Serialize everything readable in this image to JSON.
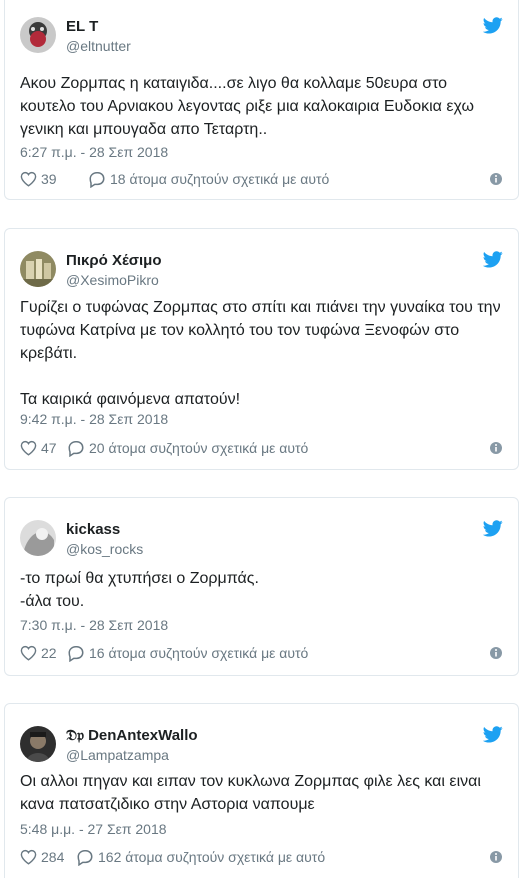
{
  "tweets": [
    {
      "name": "EL T",
      "handle": "@eltnutter",
      "text": "Ακου Ζορμπας η καταιγιδα....σε λιγο θα κολλαμε 50ευρα στο κουτελο του Αρνιακου λεγοντας ριξε μια καλοκαιρια Ευδοκια εχω γενικη και μπουγαδα απο Τεταρτη..",
      "timestamp": "6:27 π.μ. - 28 Σεπ 2018",
      "likes": "39",
      "replies": "18 άτομα συζητούν σχετικά με αυτό"
    },
    {
      "name": "Πικρό Χέσιμο",
      "handle": "@XesimoPikro",
      "text": "Γυρίζει ο τυφώνας Ζορμπας στο σπίτι  και πιάνει την γυναίκα του την τυφώνα Κατρίνα με τον κολλητό του τον τυφώνα Ξενοφών στο κρεβάτι.\n\nΤα καιρικά φαινόμενα απατούν!",
      "timestamp": "9:42 π.μ. - 28 Σεπ 2018",
      "likes": "47",
      "replies": "20 άτομα συζητούν σχετικά με αυτό"
    },
    {
      "name": "kickass",
      "handle": "@kos_rocks",
      "text": "-το πρωί θα χτυπήσει ο Ζορμπάς.\n-άλα του.",
      "timestamp": "7:30 π.μ. - 28 Σεπ 2018",
      "likes": "22",
      "replies": "16 άτομα συζητούν σχετικά με αυτό"
    },
    {
      "name": "𝔇𝔭 DenAntexWallo",
      "handle": "@Lampatzampa",
      "text": "Οι αλλοι πηγαν και ειπαν τον κυκλωνα Ζορμπας φιλε λες και ειναι κανα πατσατζιδικο στην Αστορια ναπουμε",
      "timestamp": "5:48 μ.μ. - 27 Σεπ 2018",
      "likes": "284",
      "replies": "162 άτομα συζητούν σχετικά με αυτό"
    }
  ],
  "colors": {
    "twitter_blue": "#1da1f2",
    "text": "#1c2022",
    "muted": "#697882",
    "border": "#e1e8ed"
  },
  "icons": [
    "twitter-bird-icon",
    "heart-icon",
    "reply-bubble-icon",
    "info-icon"
  ]
}
